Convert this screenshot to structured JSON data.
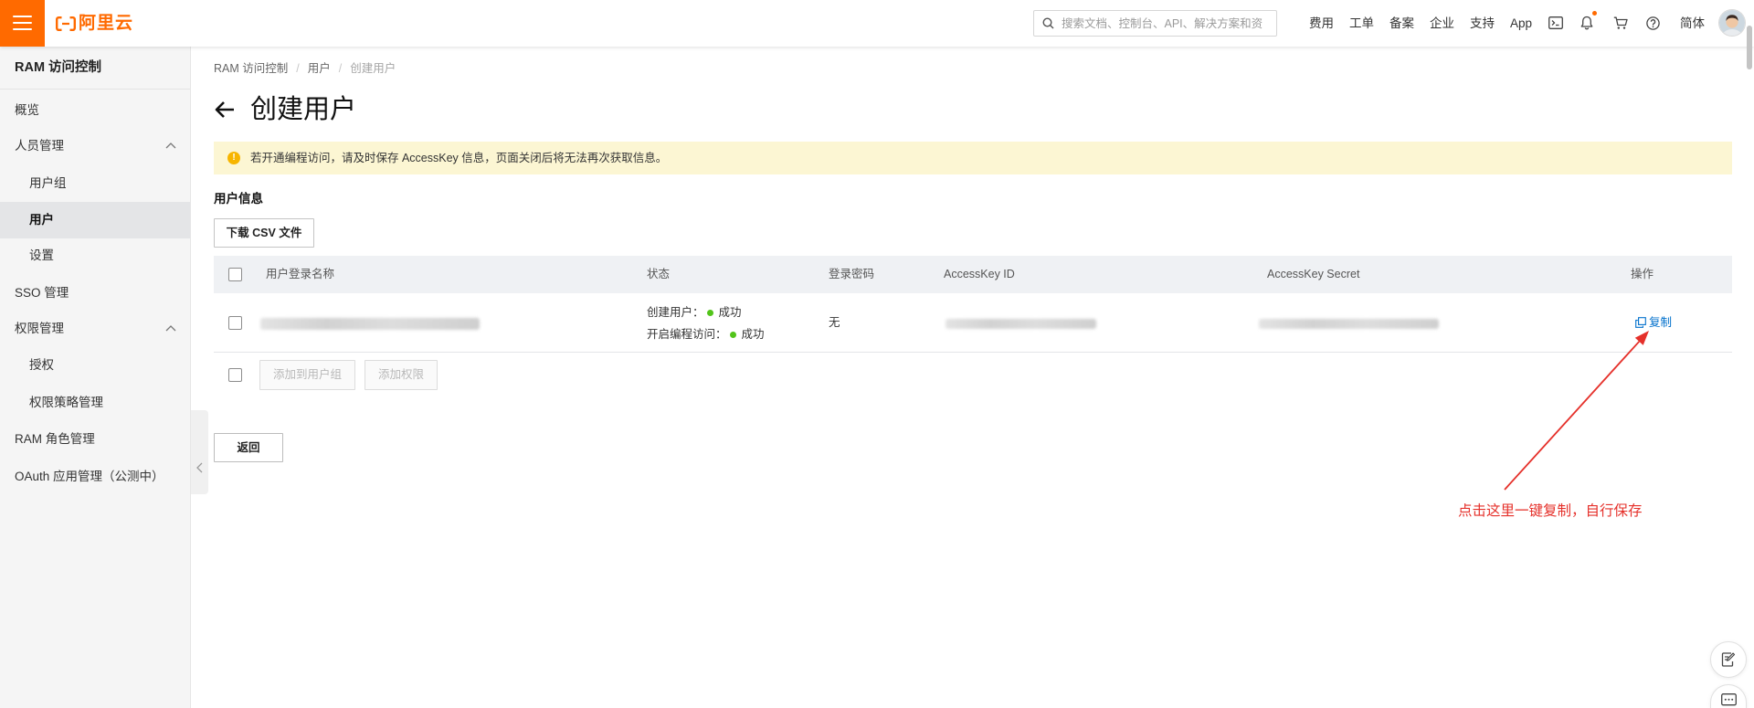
{
  "colors": {
    "brand_orange": "#ff6a00",
    "link_blue": "#0070cc",
    "success_green": "#52c41a",
    "warning_yellow": "#f7b500",
    "annotation_red": "#e5302a"
  },
  "topbar": {
    "brand": "阿里云",
    "search_placeholder": "搜索文档、控制台、API、解决方案和资",
    "nav": [
      "费用",
      "工单",
      "备案",
      "企业",
      "支持",
      "App"
    ],
    "icons": [
      "terminal-icon",
      "bell-icon",
      "cart-icon",
      "help-icon"
    ],
    "notification_dot": true,
    "language": "简体"
  },
  "sidebar": {
    "title": "RAM 访问控制",
    "items": [
      {
        "label": "概览"
      },
      {
        "label": "人员管理",
        "expanded": true
      },
      {
        "label": "用户组",
        "child": true
      },
      {
        "label": "用户",
        "child": true,
        "selected": true
      },
      {
        "label": "设置",
        "child": true
      },
      {
        "label": "SSO 管理"
      },
      {
        "label": "权限管理",
        "expanded": true
      },
      {
        "label": "授权",
        "child": true
      },
      {
        "label": "权限策略管理",
        "child": true
      },
      {
        "label": "RAM 角色管理"
      },
      {
        "label": "OAuth 应用管理（公测中）"
      }
    ]
  },
  "breadcrumb": [
    "RAM 访问控制",
    "用户",
    "创建用户"
  ],
  "page_title": "创建用户",
  "warning": "若开通编程访问，请及时保存 AccessKey 信息，页面关闭后将无法再次获取信息。",
  "section_title": "用户信息",
  "download_button": "下载 CSV 文件",
  "table": {
    "headers": [
      "用户登录名称",
      "状态",
      "登录密码",
      "AccessKey ID",
      "AccessKey Secret",
      "操作"
    ],
    "rows": [
      {
        "status": [
          {
            "label": "创建用户：",
            "value": "成功"
          },
          {
            "label": "开启编程访问：",
            "value": "成功"
          }
        ],
        "password": "无",
        "action": "复制"
      }
    ]
  },
  "batch_actions": [
    "添加到用户组",
    "添加权限"
  ],
  "back_button": "返回",
  "annotation": "点击这里一键复制，自行保存"
}
